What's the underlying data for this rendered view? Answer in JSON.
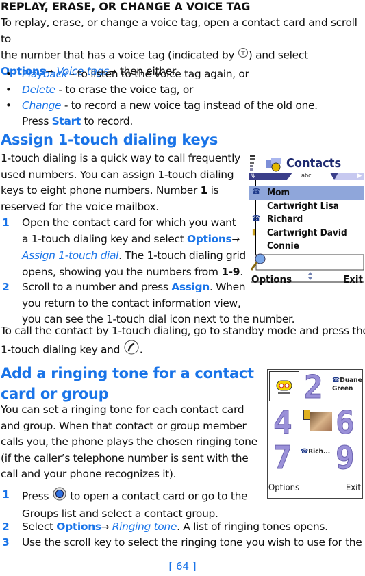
{
  "section1": {
    "heading": "REPLAY, ERASE, OR CHANGE A VOICE TAG",
    "para_l1": "To replay, erase, or change a voice tag, open a contact card and scroll to",
    "para_l2a": "the number that has a voice tag (indicated by ",
    "para_l2b": ") and select",
    "options": "Options",
    "arrow": "→",
    "voice_tags": "Voice tags",
    "then_either": " then either",
    "bullets": [
      {
        "term": "Playback",
        "rest": " - to listen to the voice tag again, or"
      },
      {
        "term": "Delete",
        "rest": " - to erase the voice tag, or"
      },
      {
        "term": "Change",
        "rest": " - to record a new voice tag instead of the old one."
      }
    ],
    "press": "Press ",
    "start": "Start",
    "to_record": " to record."
  },
  "section2": {
    "heading": "Assign 1-touch dialing keys",
    "para": [
      "1-touch dialing is a quick way to call frequently",
      "used numbers. You can assign 1-touch dialing",
      "keys to eight phone numbers. Number "
    ],
    "num1": "1",
    "is": " is",
    "reserved": "reserved for the voice mailbox.",
    "step1": {
      "n": "1",
      "l1": "Open the contact card for which you want",
      "l2": "a 1-touch dialing key and select ",
      "options": "Options",
      "assign": "Assign 1-touch dial",
      "l3": ". The 1-touch dialing grid",
      "l4": "opens, showing you the numbers from ",
      "range": "1-9",
      "dot": "."
    },
    "step2": {
      "n": "2",
      "l1a": "Scroll to a number and press ",
      "assign": "Assign",
      "l1b": ". When",
      "l2": "you return to the contact information view,",
      "l3": "you can see the 1-touch dial icon next to the number."
    },
    "call_l1": "To call the contact by 1-touch dialing, go to standby mode and press the",
    "call_l2": "1-touch dialing key and ",
    "call_end": "."
  },
  "contacts_screen": {
    "title": "Contacts",
    "tab_label": "abc",
    "contacts": [
      "Mom",
      "Cartwright Lisa",
      "Richard",
      "Cartwright David",
      "Connie"
    ],
    "contact_icons": [
      "phone-icon",
      "",
      "phone-icon",
      "mobile-icon",
      ""
    ],
    "selected_index": 0,
    "softkey_left": "Options",
    "softkey_right": "Exit"
  },
  "section3": {
    "heading_l1": "Add a ringing tone for a contact",
    "heading_l2": "card or group",
    "para": [
      "You can set a ringing tone for each contact card",
      "and group. When that contact or group member",
      "calls you, the phone plays the chosen ringing tone",
      "(if the caller’s telephone number is sent with the",
      "call and your phone recognizes it)."
    ],
    "step1": {
      "n": "1",
      "a": "Press ",
      "b": " to open a contact card or go to the",
      "l2": "Groups list and select a contact group."
    },
    "step2": {
      "n": "2",
      "a": "Select ",
      "options": "Options",
      "ring": "Ringing tone",
      "b": ". A list of ringing tones opens."
    },
    "step3": {
      "n": "3",
      "a": "Use the scroll key to select the ringing tone you wish to use for the"
    }
  },
  "dial_screen": {
    "digits": [
      "2",
      "4",
      "6",
      "7",
      "9"
    ],
    "name_top_l1": "Duane",
    "name_top_l2": "Green",
    "name_mid": "Rich...",
    "softkey_left": "Options",
    "softkey_right": "Exit"
  },
  "footer": {
    "page": "[ 64 ]"
  }
}
